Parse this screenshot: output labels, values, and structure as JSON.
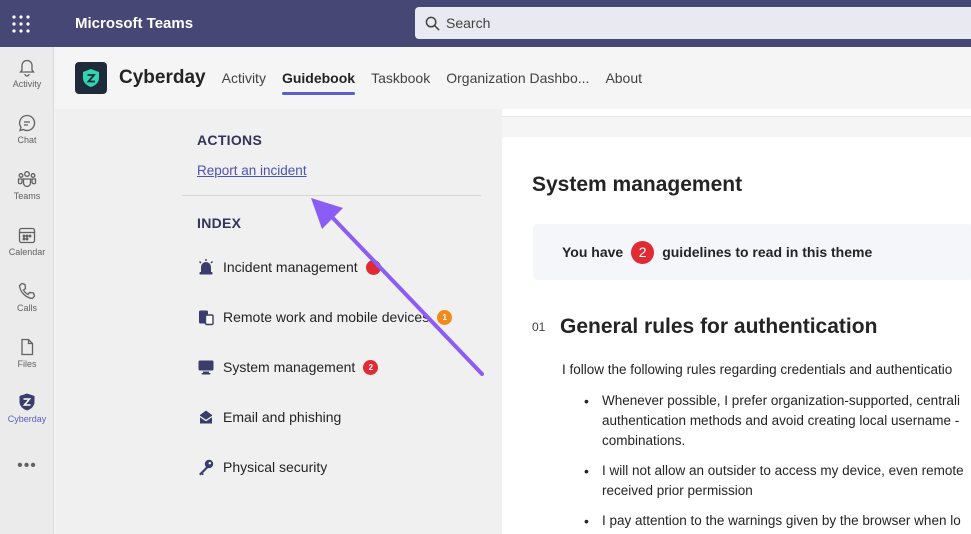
{
  "topbar": {
    "title": "Microsoft Teams",
    "search_placeholder": "Search"
  },
  "rail": {
    "items": [
      {
        "label": "Activity",
        "icon": "bell-icon"
      },
      {
        "label": "Chat",
        "icon": "chat-icon"
      },
      {
        "label": "Teams",
        "icon": "teams-icon"
      },
      {
        "label": "Calendar",
        "icon": "calendar-icon"
      },
      {
        "label": "Calls",
        "icon": "phone-icon"
      },
      {
        "label": "Files",
        "icon": "file-icon"
      },
      {
        "label": "Cyberday",
        "icon": "cyberday-icon"
      }
    ],
    "more": "•••"
  },
  "app": {
    "name": "Cyberday",
    "tabs": [
      {
        "label": "Activity"
      },
      {
        "label": "Guidebook"
      },
      {
        "label": "Taskbook"
      },
      {
        "label": "Organization Dashbo..."
      },
      {
        "label": "About"
      }
    ],
    "active_tab": "Guidebook"
  },
  "left": {
    "actions_title": "ACTIONS",
    "report_link": "Report an incident",
    "index_title": "INDEX",
    "index": [
      {
        "label": "Incident management",
        "badge": "",
        "badge_color": "#e02b35"
      },
      {
        "label": "Remote work and mobile devices",
        "badge": "1",
        "badge_color": "#f28a1b"
      },
      {
        "label": "System management",
        "badge": "2",
        "badge_color": "#e02b35"
      },
      {
        "label": "Email and phishing",
        "badge": "",
        "badge_color": ""
      },
      {
        "label": "Physical security",
        "badge": "",
        "badge_color": ""
      }
    ]
  },
  "main": {
    "theme_title": "System management",
    "notice_prefix": "You have",
    "notice_count": "2",
    "notice_suffix": "guidelines to read in this theme",
    "rule_number": "01",
    "rule_title": "General rules for authentication",
    "rule_intro": "I follow the following rules regarding credentials and authenticatio",
    "rule_items": [
      {
        "line1": "Whenever possible, I prefer organization-supported, centrali",
        "line2": "authentication methods and avoid creating local username -",
        "line3": "combinations."
      },
      {
        "line1": "I will not allow an outsider to access my device, even remote",
        "line2": "received prior permission",
        "line3": ""
      },
      {
        "line1": "I pay attention to the warnings given by the browser when lo",
        "line2": "",
        "line3": ""
      }
    ]
  },
  "colors": {
    "topbar": "#464775",
    "accent": "#5b5fc7",
    "arrow": "#8b5cf6",
    "badge_red": "#e02b35",
    "badge_orange": "#f28a1b"
  }
}
